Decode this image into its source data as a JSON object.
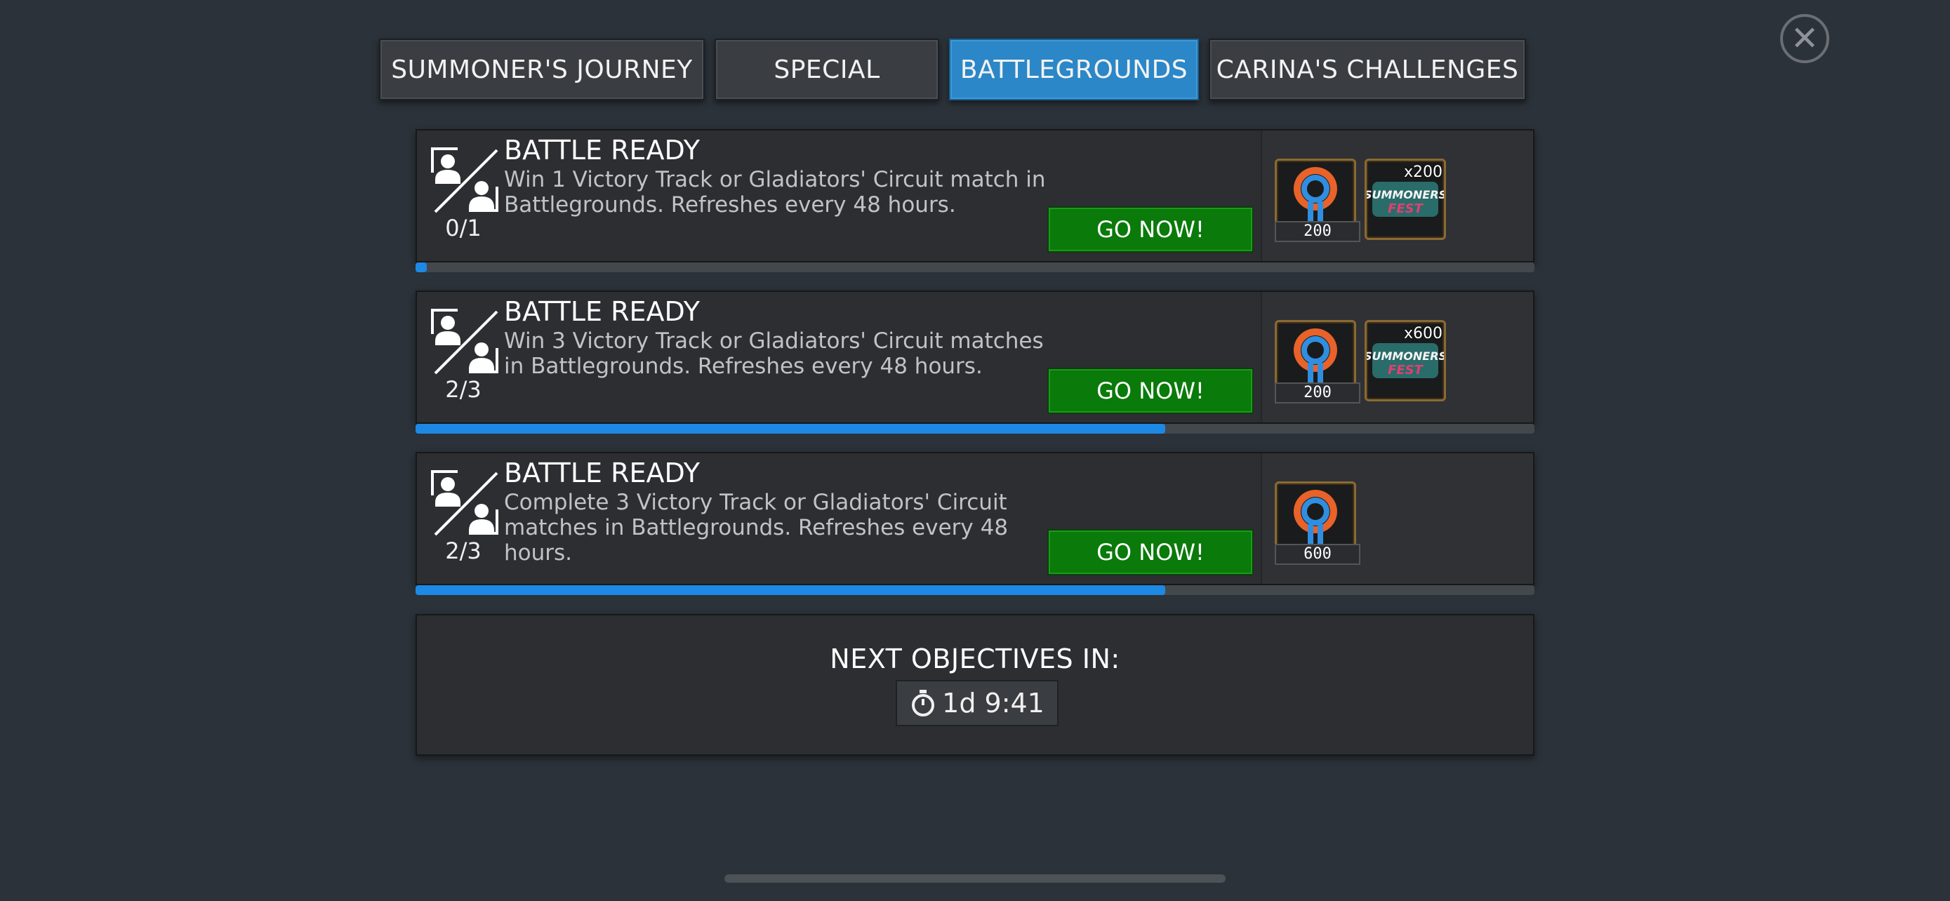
{
  "tabs": [
    {
      "label": "SUMMONER'S JOURNEY",
      "active": false
    },
    {
      "label": "SPECIAL",
      "active": false
    },
    {
      "label": "BATTLEGROUNDS",
      "active": true
    },
    {
      "label": "CARINA'S CHALLENGES",
      "active": false
    }
  ],
  "close_icon": "close-icon",
  "quests": [
    {
      "title": "BATTLE READY",
      "description": "Win 1 Victory Track or Gladiators' Circuit match in Battlegrounds. Refreshes every 48 hours.",
      "progress_text": "0/1",
      "progress_fraction": 0.01,
      "button_label": "GO NOW!",
      "rewards": [
        {
          "icon": "battlegrounds-currency-icon",
          "count": "200"
        },
        {
          "icon": "summoners-fest-icon",
          "multiplier": "x200"
        }
      ]
    },
    {
      "title": "BATTLE READY",
      "description": "Win 3 Victory Track or Gladiators' Circuit matches in Battlegrounds. Refreshes every 48 hours.",
      "progress_text": "2/3",
      "progress_fraction": 0.67,
      "button_label": "GO NOW!",
      "rewards": [
        {
          "icon": "battlegrounds-currency-icon",
          "count": "200"
        },
        {
          "icon": "summoners-fest-icon",
          "multiplier": "x600"
        }
      ]
    },
    {
      "title": "BATTLE READY",
      "description": "Complete 3 Victory Track or Gladiators' Circuit matches in Battlegrounds. Refreshes every 48 hours.",
      "progress_text": "2/3",
      "progress_fraction": 0.67,
      "button_label": "GO NOW!",
      "rewards": [
        {
          "icon": "battlegrounds-currency-icon",
          "count": "600"
        }
      ]
    }
  ],
  "next_objectives": {
    "label": "NEXT OBJECTIVES IN:",
    "timer": "1d 9:41",
    "timer_icon": "stopwatch-icon"
  },
  "colors": {
    "accent": "#2b87c7",
    "go_button": "#0a7a0a",
    "progress": "#1e88e5",
    "background": "#2b3239"
  }
}
